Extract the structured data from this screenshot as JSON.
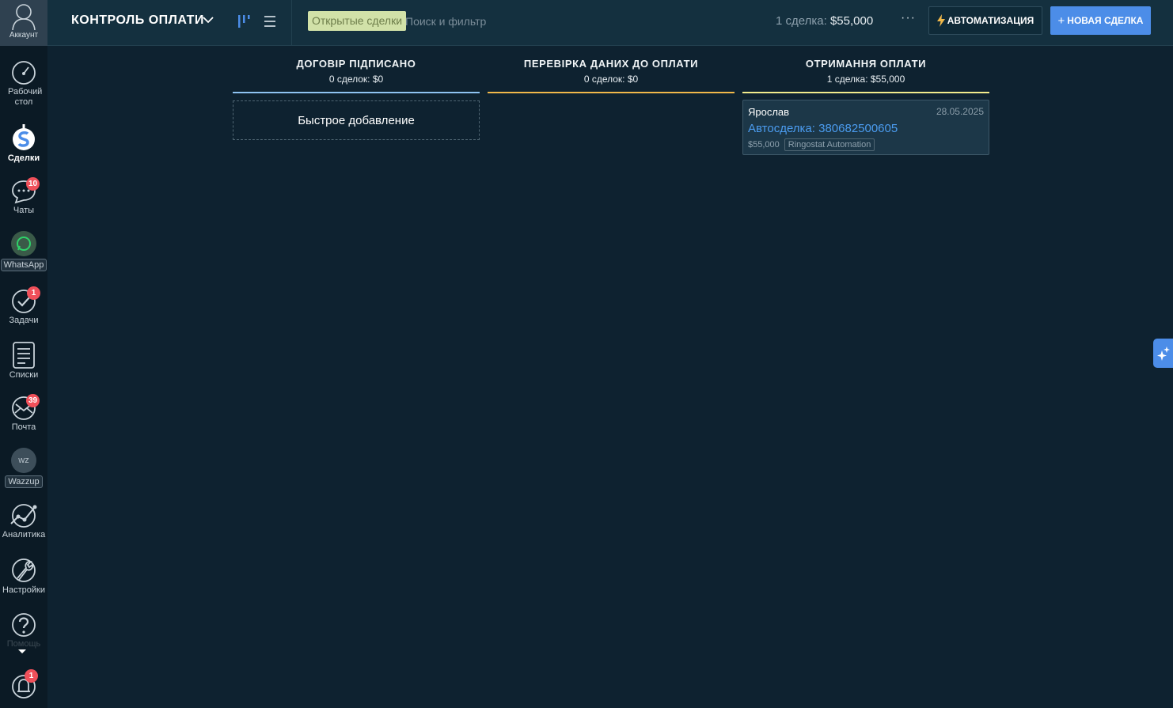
{
  "sidebar": {
    "account_label": "Аккаунт",
    "items": [
      {
        "label": "Рабочий стол"
      },
      {
        "label": "Сделки"
      },
      {
        "label": "Чаты",
        "badge": "10"
      },
      {
        "label": "WhatsApp"
      },
      {
        "label": "Задачи",
        "badge": "1"
      },
      {
        "label": "Списки"
      },
      {
        "label": "Почта",
        "badge": "39"
      },
      {
        "label": "Wazzup",
        "icon_text": "wz"
      },
      {
        "label": "Аналитика"
      },
      {
        "label": "Настройки"
      },
      {
        "label": "Помощь"
      },
      {
        "label": "",
        "badge": "1"
      }
    ]
  },
  "topbar": {
    "pipeline_title": "КОНТРОЛЬ ОПЛАТИ",
    "filter_tag": "Открытые сделки",
    "search_placeholder": "Поиск и фильтр",
    "summary_count": "1 сделка:",
    "summary_amount": "$55,000",
    "more_label": "···",
    "automation_label": "АВТОМАТИЗАЦИЯ",
    "new_deal_label": "НОВАЯ СДЕЛКА"
  },
  "columns": [
    {
      "title": "ДОГОВІР ПІДПИСАНО",
      "subtitle": "0 сделок: $0",
      "color": "#8ec3f2",
      "quick_add": "Быстрое добавление"
    },
    {
      "title": "ПЕРЕВІРКА ДАНИХ ДО ОПЛАТИ",
      "subtitle": "0 сделок: $0",
      "color": "#f0b84a"
    },
    {
      "title": "ОТРИМАННЯ ОПЛАТИ",
      "subtitle": "1 сделка: $55,000",
      "color": "#f2eb8c",
      "cards": [
        {
          "user": "Ярослав",
          "date": "28.05.2025",
          "name": "Автосделка: 380682500605",
          "price": "$55,000",
          "tag": "Ringostat Automation"
        }
      ]
    }
  ],
  "colors": {
    "accent": "#4c8de8",
    "badge": "#f0505a",
    "background": "#0e2230"
  }
}
